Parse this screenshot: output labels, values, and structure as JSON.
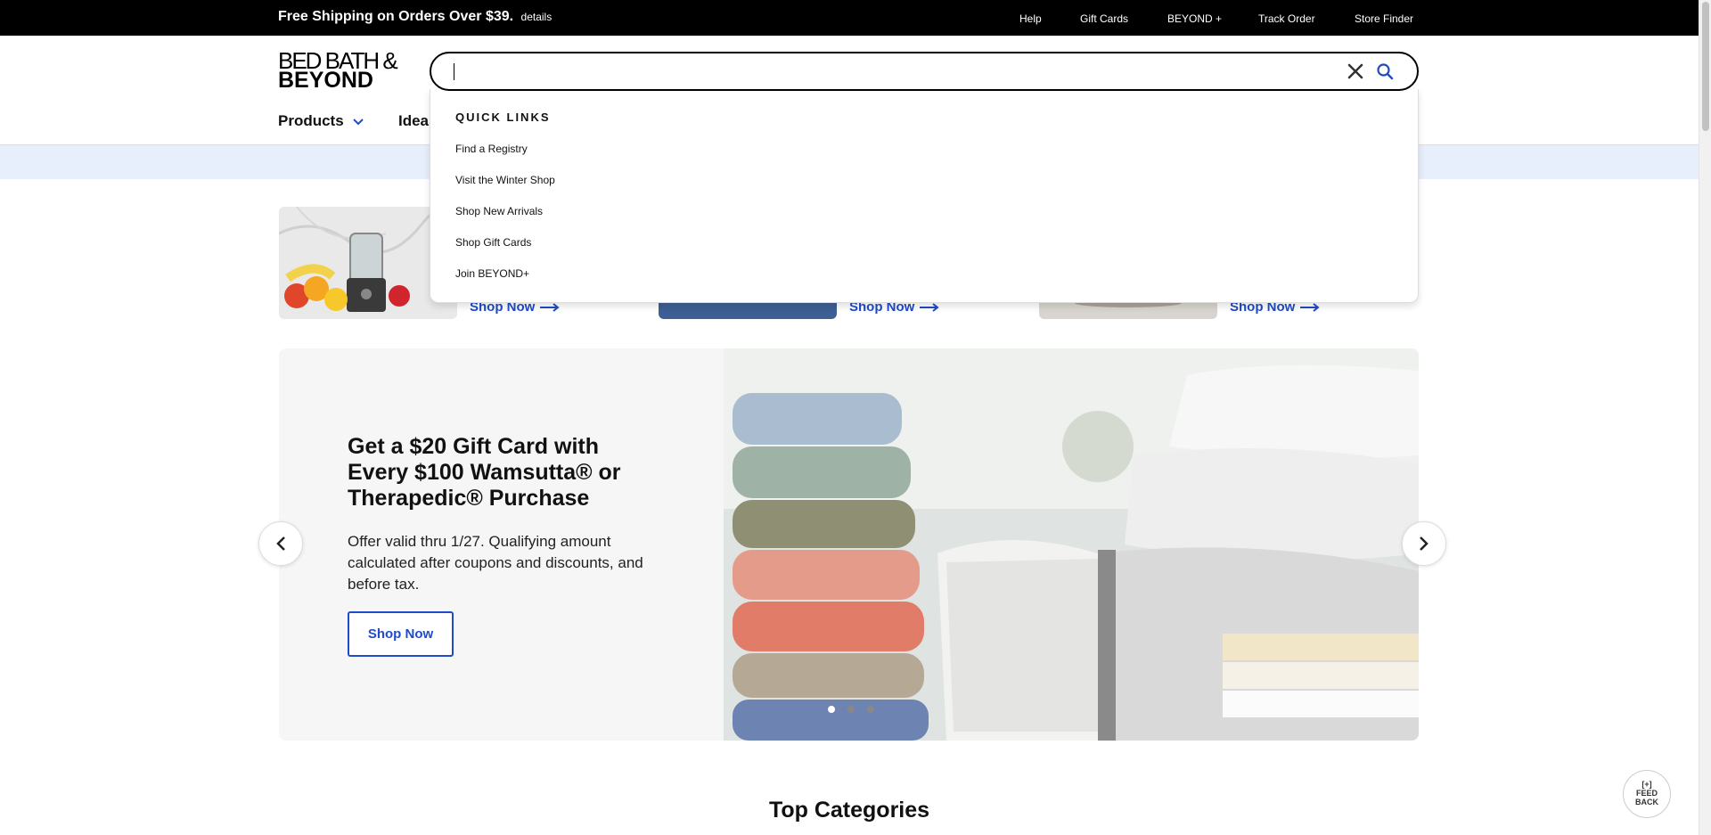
{
  "topbar": {
    "promo": "Free Shipping on Orders Over $39.",
    "details": "details",
    "links": [
      "Help",
      "Gift Cards",
      "BEYOND +",
      "Track Order",
      "Store Finder"
    ]
  },
  "header": {
    "logo_line1": "BED BATH &",
    "logo_line2": "BEYOND",
    "nav_products": "Products",
    "nav_ideas": "Ideas"
  },
  "search": {
    "value": "",
    "placeholder": ""
  },
  "quick_links": {
    "title": "QUICK LINKS",
    "items": [
      "Find a Registry",
      "Visit the Winter Shop",
      "Shop New Arrivals",
      "Shop Gift Cards",
      "Join BEYOND+"
    ]
  },
  "promos": {
    "shop_now": [
      "Shop Now",
      "Shop Now",
      "Shop Now"
    ]
  },
  "hero": {
    "title": "Get a $20 Gift Card with Every $100 Wamsutta® or Therapedic® Purchase",
    "subtitle": "Offer valid thru 1/27. Qualifying amount calculated after coupons and discounts, and before tax.",
    "button": "Shop Now",
    "active_slide": 1,
    "slide_count": 3
  },
  "sections": {
    "top_categories": "Top Categories"
  },
  "feedback": {
    "line1": "[+]",
    "line2": "FEED",
    "line3": "BACK"
  },
  "colors": {
    "accent_blue": "#1f4bc8",
    "topbar_bg": "#000000",
    "banner_bg": "#e7eefc"
  }
}
